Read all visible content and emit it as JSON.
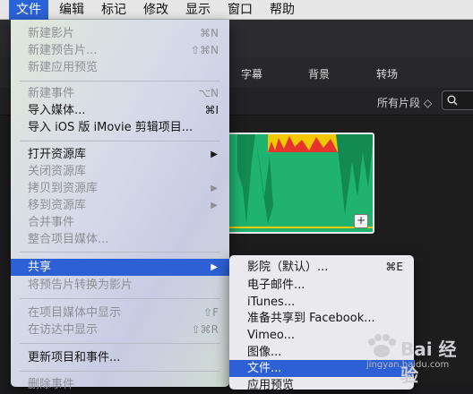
{
  "menubar": {
    "items": [
      "文件",
      "编辑",
      "标记",
      "修改",
      "显示",
      "窗口",
      "帮助"
    ]
  },
  "app": {
    "tabs": [
      "字幕",
      "背景",
      "转场"
    ],
    "filter_label": "所有片段 ◇"
  },
  "file_menu": {
    "items": [
      {
        "label": "新建影片",
        "shortcut": "⌘N",
        "disabled": true
      },
      {
        "label": "新建预告片...",
        "shortcut": "⇧⌘N",
        "disabled": true
      },
      {
        "label": "新建应用预览",
        "shortcut": "",
        "disabled": true
      },
      {
        "label": "新建事件",
        "shortcut": "⌥N",
        "disabled": true
      },
      {
        "label": "导入媒体...",
        "shortcut": "⌘I",
        "disabled": false
      },
      {
        "label": "导入 iOS 版 iMovie 剪辑项目...",
        "shortcut": "",
        "disabled": false
      },
      {
        "label": "打开资源库",
        "shortcut": "",
        "disabled": false,
        "submenu": true
      },
      {
        "label": "关闭资源库",
        "shortcut": "",
        "disabled": true
      },
      {
        "label": "拷贝到资源库",
        "shortcut": "",
        "disabled": true,
        "submenu": true
      },
      {
        "label": "移到资源库",
        "shortcut": "",
        "disabled": true,
        "submenu": true
      },
      {
        "label": "合并事件",
        "shortcut": "",
        "disabled": true
      },
      {
        "label": "整合项目媒体...",
        "shortcut": "",
        "disabled": true
      },
      {
        "label": "共享",
        "shortcut": "",
        "disabled": false,
        "submenu": true,
        "highlight": true
      },
      {
        "label": "将预告片转换为影片",
        "shortcut": "",
        "disabled": true
      },
      {
        "label": "在项目媒体中显示",
        "shortcut": "⇧F",
        "disabled": true
      },
      {
        "label": "在访达中显示",
        "shortcut": "⇧⌘R",
        "disabled": true
      },
      {
        "label": "更新项目和事件...",
        "shortcut": "",
        "disabled": false
      },
      {
        "label": "删除事件",
        "shortcut": "",
        "disabled": true
      }
    ]
  },
  "share_menu": {
    "items": [
      {
        "label": "影院（默认）...",
        "shortcut": "⌘E"
      },
      {
        "label": "电子邮件...",
        "shortcut": ""
      },
      {
        "label": "iTunes...",
        "shortcut": ""
      },
      {
        "label": "准备共享到 Facebook...",
        "shortcut": ""
      },
      {
        "label": "Vimeo...",
        "shortcut": ""
      },
      {
        "label": "图像...",
        "shortcut": ""
      },
      {
        "label": "文件...",
        "shortcut": "",
        "highlight": true
      },
      {
        "label": "应用预览",
        "shortcut": ""
      }
    ]
  },
  "watermark": {
    "brand": "Bai 经验",
    "url": "jingyan.baidu.com"
  }
}
